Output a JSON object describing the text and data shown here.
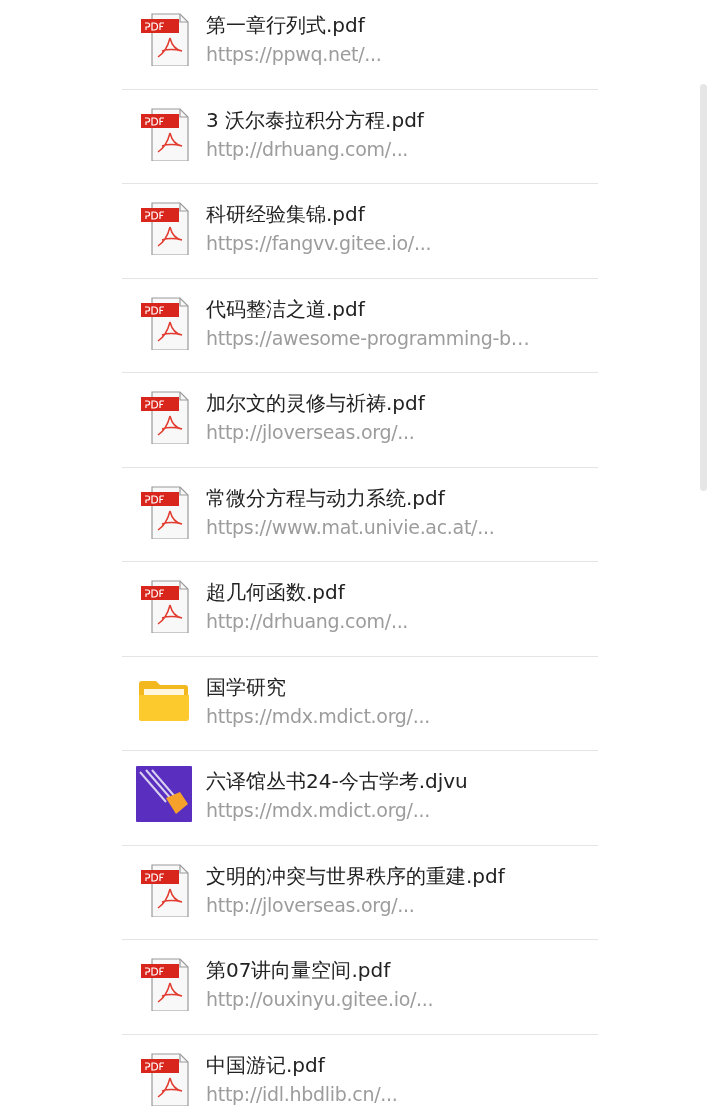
{
  "files": [
    {
      "kind": "pdf",
      "name": "第一章行列式.pdf",
      "source": "https://ppwq.net/..."
    },
    {
      "kind": "pdf",
      "name": "3 沃尔泰拉积分方程.pdf",
      "source": "http://drhuang.com/..."
    },
    {
      "kind": "pdf",
      "name": "科研经验集锦.pdf",
      "source": "https://fangvv.gitee.io/..."
    },
    {
      "kind": "pdf",
      "name": "代码整洁之道.pdf",
      "source": "https://awesome-programming-b…"
    },
    {
      "kind": "pdf",
      "name": "加尔文的灵修与祈祷.pdf",
      "source": "http://jloverseas.org/..."
    },
    {
      "kind": "pdf",
      "name": "常微分方程与动力系统.pdf",
      "source": "https://www.mat.univie.ac.at/..."
    },
    {
      "kind": "pdf",
      "name": "超几何函数.pdf",
      "source": "http://drhuang.com/..."
    },
    {
      "kind": "folder",
      "name": "国学研究",
      "source": "https://mdx.mdict.org/..."
    },
    {
      "kind": "djvu",
      "name": "六译馆丛书24-今古学考.djvu",
      "source": "https://mdx.mdict.org/..."
    },
    {
      "kind": "pdf",
      "name": "文明的冲突与世界秩序的重建.pdf",
      "source": "http://jloverseas.org/..."
    },
    {
      "kind": "pdf",
      "name": "第07讲向量空间.pdf",
      "source": "http://ouxinyu.gitee.io/..."
    },
    {
      "kind": "pdf",
      "name": "中国游记.pdf",
      "source": "http://idl.hbdlib.cn/..."
    }
  ]
}
